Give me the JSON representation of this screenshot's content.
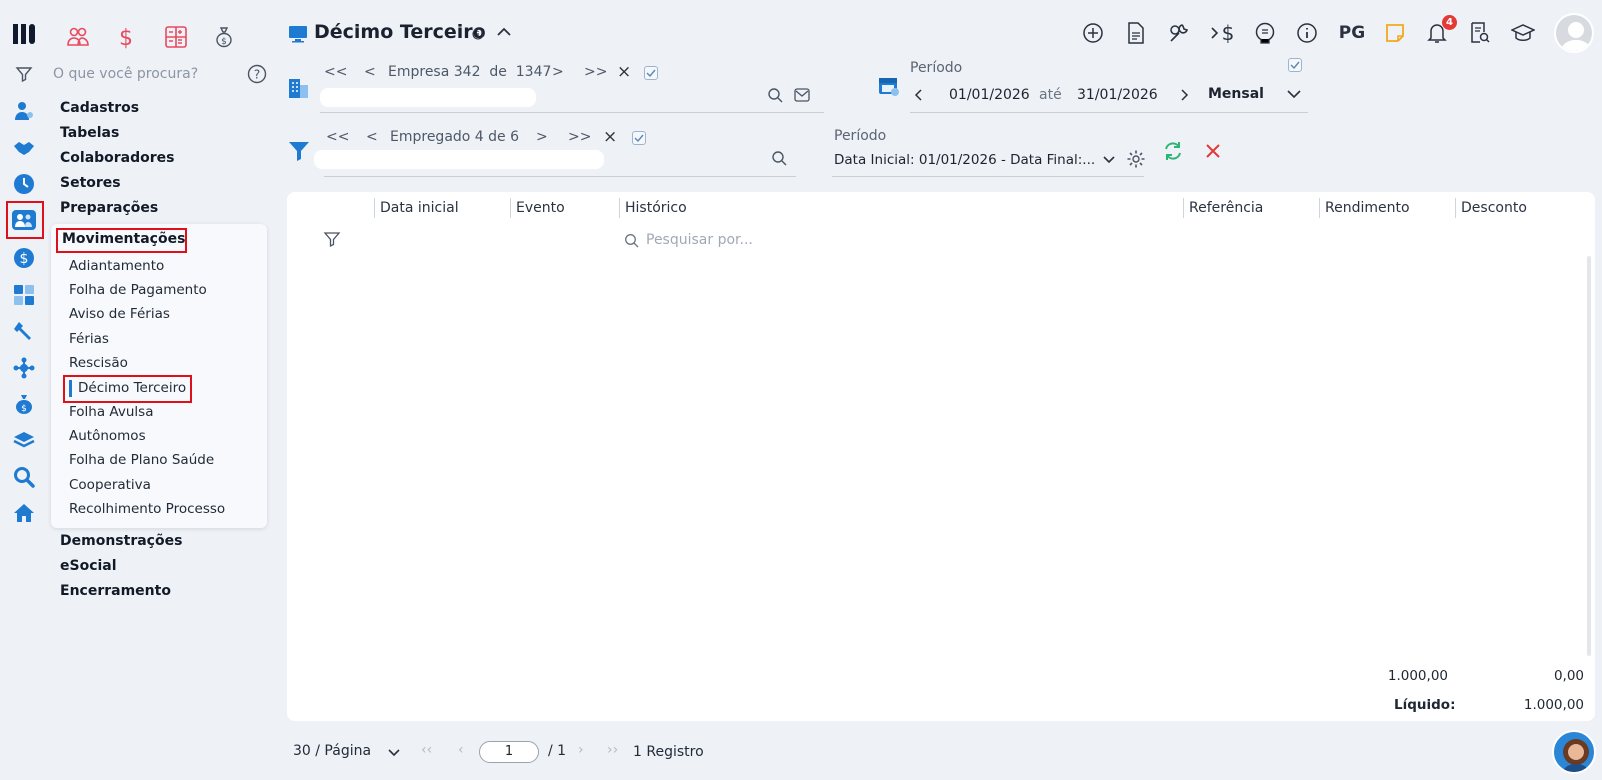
{
  "app": {
    "logo": "app-logo"
  },
  "quick_icons": [
    "users-icon",
    "dollar-icon",
    "calculator-icon",
    "money-bag-icon"
  ],
  "search": {
    "placeholder": "O que você procura?"
  },
  "menu": {
    "items": [
      "Cadastros",
      "Tabelas",
      "Colaboradores",
      "Setores",
      "Preparações",
      "Movimentações"
    ],
    "sub_items": [
      "Adiantamento",
      "Folha de Pagamento",
      "Aviso de Férias",
      "Férias",
      "Rescisão",
      "Décimo Terceiro",
      "Folha Avulsa",
      "Autônomos",
      "Folha de Plano Saúde",
      "Cooperativa",
      "Recolhimento Processo"
    ],
    "after_items": [
      "Demonstrações",
      "eSocial",
      "Encerramento"
    ],
    "active_sub": "Décimo Terceiro"
  },
  "header": {
    "title": "Décimo Terceiro",
    "pg_label": "PG",
    "notification_count": "4",
    "icons": [
      "add-circle-icon",
      "document-icon",
      "tools-icon",
      "currency-transfer-icon",
      "brain-icon",
      "info-icon",
      "pg-icon",
      "sticky-note-icon",
      "bell-icon",
      "report-search-icon",
      "graduation-cap-icon",
      "user-avatar-icon"
    ]
  },
  "empresa_nav": {
    "first": "<<",
    "prev": "<",
    "label": "Empresa 342  de  1347",
    "next": ">",
    "last": ">>",
    "clear": "×"
  },
  "empregado_nav": {
    "first": "<<",
    "prev": "<",
    "label": "Empregado 4 de 6",
    "next": ">",
    "last": ">>",
    "clear": "×"
  },
  "periodo_top": {
    "label": "Período",
    "start": "01/01/2026",
    "sep": "até",
    "end": "31/01/2026",
    "mode": "Mensal"
  },
  "periodo_filter": {
    "label": "Período",
    "value": "Data Inicial: 01/01/2026 - Data Final:..."
  },
  "table": {
    "columns": [
      "Data inicial",
      "Evento",
      "Histórico",
      "Referência",
      "Rendimento",
      "Desconto"
    ],
    "search_placeholder": "Pesquisar por...",
    "totals": {
      "rendimento": "1.000,00",
      "desconto": "0,00",
      "liquido_label": "Líquido:",
      "liquido": "1.000,00"
    }
  },
  "pagination": {
    "per_page": "30 / Página",
    "current_page": "1",
    "total_pages": "/ 1",
    "records": "1 Registro"
  },
  "colors": {
    "accent": "#1a73c8",
    "danger": "#e0101a",
    "quick_icon": "#e84a5f",
    "refresh": "#2bb673",
    "close": "#e53935"
  }
}
